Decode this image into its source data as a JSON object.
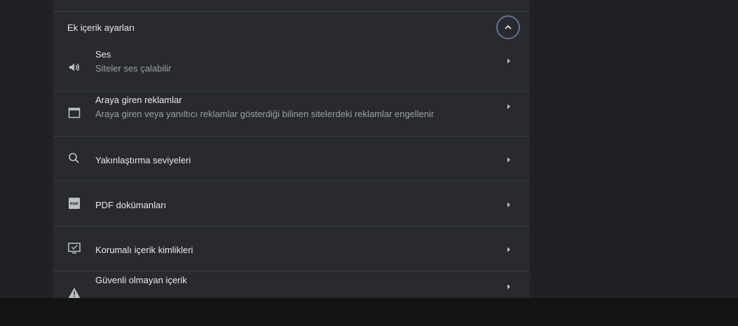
{
  "section": {
    "title": "Ek içerik ayarları",
    "collapse_icon": "chevron-up-icon"
  },
  "rows": [
    {
      "title": "Ses",
      "subtitle": "Siteler ses çalabilir",
      "icon": "speaker-icon"
    },
    {
      "title": "Araya giren reklamlar",
      "subtitle": "Araya giren veya yanıltıcı reklamlar gösterdiği bilinen sitelerdeki reklamlar engellenir",
      "icon": "window-icon"
    },
    {
      "title": "Yakınlaştırma seviyeleri",
      "subtitle": "",
      "icon": "search-icon"
    },
    {
      "title": "PDF dokümanları",
      "subtitle": "",
      "icon": "pdf-icon"
    },
    {
      "title": "Korumalı içerik kimlikleri",
      "subtitle": "",
      "icon": "monitor-check-icon"
    },
    {
      "title": "Güvenli olmayan içerik",
      "subtitle": "",
      "icon": "warning-icon"
    }
  ],
  "colors": {
    "background": "#202124",
    "card": "#292a2d",
    "text_primary": "#e8eaed",
    "text_secondary": "#9aa0a6",
    "divider": "#3c4043",
    "focus_ring": "#5f7494",
    "taskbar": "#131313"
  }
}
